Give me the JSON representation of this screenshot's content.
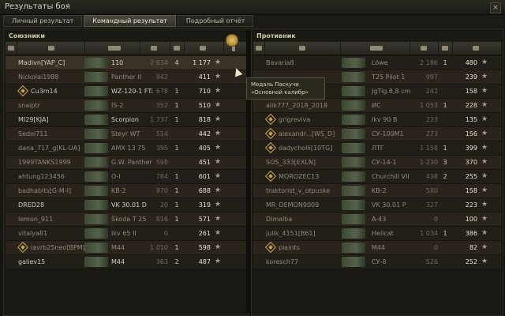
{
  "window": {
    "title": "Результаты боя",
    "close_label": "×"
  },
  "tabs": [
    {
      "label": "Личный результат",
      "active": false
    },
    {
      "label": "Командный результат",
      "active": true
    },
    {
      "label": "Подробный отчёт",
      "active": false
    }
  ],
  "allies": {
    "title": "Союзники",
    "rows": [
      {
        "name": "Madivn[YAP_C]",
        "vehicle": "110",
        "damage": "2 634",
        "frags": "4",
        "xp": "1 177",
        "alive": true,
        "platoon": false,
        "self": true
      },
      {
        "name": "Nickolai1988",
        "vehicle": "Panther II",
        "damage": "942",
        "frags": "",
        "xp": "411",
        "alive": false,
        "platoon": false
      },
      {
        "name": "Cu3m14",
        "vehicle": "WZ-120-1 FT",
        "damage": "1 678",
        "frags": "1",
        "xp": "710",
        "alive": true,
        "platoon": true
      },
      {
        "name": "snaiptr",
        "vehicle": "IS-2",
        "damage": "352",
        "frags": "1",
        "xp": "510",
        "alive": false,
        "platoon": false
      },
      {
        "name": "MI29[KJA]",
        "vehicle": "Scorpion",
        "damage": "1 737",
        "frags": "1",
        "xp": "818",
        "alive": true,
        "platoon": false
      },
      {
        "name": "Sedoi711",
        "vehicle": "Steyr WT",
        "damage": "514",
        "frags": "",
        "xp": "442",
        "alive": false,
        "platoon": false
      },
      {
        "name": "dana_717_g[KL-UA]",
        "vehicle": "AMX 13 75",
        "damage": "395",
        "frags": "1",
        "xp": "405",
        "alive": false,
        "platoon": false
      },
      {
        "name": "1999TANKS1999",
        "vehicle": "G.W. Panther",
        "damage": "598",
        "frags": "",
        "xp": "451",
        "alive": false,
        "platoon": false
      },
      {
        "name": "ahtung123456",
        "vehicle": "O-I",
        "damage": "784",
        "frags": "1",
        "xp": "601",
        "alive": false,
        "platoon": false
      },
      {
        "name": "badhabits[G-M-I]",
        "vehicle": "KB-2",
        "damage": "970",
        "frags": "1",
        "xp": "688",
        "alive": false,
        "platoon": false
      },
      {
        "name": "DRED28",
        "vehicle": "VK 30.01 D",
        "damage": "20",
        "frags": "1",
        "xp": "319",
        "alive": true,
        "platoon": false
      },
      {
        "name": "lemon_911",
        "vehicle": "Škoda T 25",
        "damage": "816",
        "frags": "1",
        "xp": "571",
        "alive": false,
        "platoon": false
      },
      {
        "name": "vitalya81",
        "vehicle": "Ikv 65 II",
        "damage": "0",
        "frags": "",
        "xp": "261",
        "alive": false,
        "platoon": false
      },
      {
        "name": "lavrb25neo[BPM]",
        "vehicle": "M44",
        "damage": "1 010",
        "frags": "1",
        "xp": "598",
        "alive": false,
        "platoon": true
      },
      {
        "name": "galiev15",
        "vehicle": "M44",
        "damage": "363",
        "frags": "2",
        "xp": "487",
        "alive": true,
        "platoon": false
      }
    ]
  },
  "enemies": {
    "title": "Противник",
    "rows": [
      {
        "name": "Bavaria8",
        "vehicle": "Löwe",
        "damage": "2 186",
        "frags": "1",
        "xp": "480",
        "alive": false,
        "platoon": false
      },
      {
        "name": "",
        "vehicle": "T25 Pilot 1",
        "damage": "997",
        "frags": "",
        "xp": "239",
        "alive": false,
        "platoon": false
      },
      {
        "name": "",
        "vehicle": "JgTig.8,8 cm",
        "damage": "242",
        "frags": "",
        "xp": "158",
        "alive": false,
        "platoon": false
      },
      {
        "name": "alik777_2018_2018",
        "vehicle": "ИС",
        "damage": "1 053",
        "frags": "1",
        "xp": "228",
        "alive": false,
        "platoon": false
      },
      {
        "name": "grigreviva",
        "vehicle": "Ikv 90 B",
        "damage": "233",
        "frags": "",
        "xp": "135",
        "alive": false,
        "platoon": true
      },
      {
        "name": "alexandr...[WS_D]",
        "vehicle": "СУ-100М1",
        "damage": "273",
        "frags": "",
        "xp": "156",
        "alive": false,
        "platoon": true
      },
      {
        "name": "dadycholli[10TG]",
        "vehicle": "ЛТГ",
        "damage": "1 158",
        "frags": "1",
        "xp": "399",
        "alive": false,
        "platoon": true
      },
      {
        "name": "SOS_333[EXLN]",
        "vehicle": "СУ-14-1",
        "damage": "1 230",
        "frags": "3",
        "xp": "370",
        "alive": false,
        "platoon": false
      },
      {
        "name": "MOROZEC13",
        "vehicle": "Churchill VII",
        "damage": "438",
        "frags": "2",
        "xp": "255",
        "alive": false,
        "platoon": true
      },
      {
        "name": "traktorist_v_otpuske",
        "vehicle": "KB-2",
        "damage": "580",
        "frags": "",
        "xp": "158",
        "alive": false,
        "platoon": false
      },
      {
        "name": "MR_DEMON9009",
        "vehicle": "VK 30.01 P",
        "damage": "327",
        "frags": "",
        "xp": "223",
        "alive": false,
        "platoon": false
      },
      {
        "name": "Dimalba",
        "vehicle": "A-43",
        "damage": "0",
        "frags": "",
        "xp": "100",
        "alive": false,
        "platoon": false
      },
      {
        "name": "julik_4151[B61]",
        "vehicle": "Hellcat",
        "damage": "1 034",
        "frags": "1",
        "xp": "386",
        "alive": false,
        "platoon": false
      },
      {
        "name": "plaints",
        "vehicle": "M44",
        "damage": "0",
        "frags": "",
        "xp": "82",
        "alive": false,
        "platoon": true
      },
      {
        "name": "koresch77",
        "vehicle": "СУ-8",
        "damage": "526",
        "frags": "",
        "xp": "252",
        "alive": false,
        "platoon": false
      }
    ]
  },
  "tooltip": {
    "line1": "Медаль Паскучи",
    "line2": "«Основной калибр»"
  },
  "star_glyph": "★",
  "icons": [
    "close-icon",
    "tank-class-icon",
    "player-icon",
    "vehicle-icon",
    "damage-icon",
    "frags-icon",
    "xp-icon",
    "medal-icon",
    "platoon-icon",
    "cursor-icon"
  ],
  "colors": {
    "accent": "#c9a34a",
    "self_row": "#3a3224",
    "dead_text": "#8f8a78"
  }
}
